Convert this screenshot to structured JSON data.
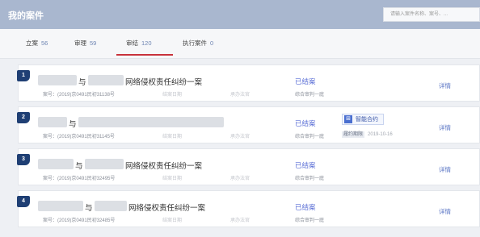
{
  "header": {
    "title": "我的案件",
    "search_placeholder": "请输入案件名称、案号、..."
  },
  "tabs": [
    {
      "label": "立案",
      "count": "56"
    },
    {
      "label": "审理",
      "count": "59"
    },
    {
      "label": "审结",
      "count": "120"
    },
    {
      "label": "执行案件",
      "count": "0"
    }
  ],
  "active_tab": "审结",
  "cases": [
    {
      "number": "1",
      "joiner": "与",
      "title_suffix": "网络侵权责任纠纷一案",
      "case_no": "案号：(2019)京0491民初31138号",
      "filing_date": "结案日期",
      "judge": "承办法官",
      "status": "已结案",
      "court": "综合审判一庭",
      "details": "详情"
    },
    {
      "number": "2",
      "joiner": "与",
      "title_suffix": "",
      "case_no": "案号：(2019)京0491民初31145号",
      "filing_date": "结案日期",
      "judge": "承办法官",
      "status": "已结案",
      "court": "综合审判一庭",
      "smart_contract": "智能合约",
      "archive_label": "履约期限",
      "archive_date": "2019-10-16",
      "details": "详情"
    },
    {
      "number": "3",
      "joiner": "与",
      "title_suffix": "网络侵权责任纠纷一案",
      "case_no": "案号：(2019)京0491民初32495号",
      "filing_date": "结案日期",
      "judge": "承办法官",
      "status": "已结案",
      "court": "综合审判一庭",
      "details": "详情"
    },
    {
      "number": "4",
      "joiner": "与",
      "title_suffix": "网络侵权责任纠纷一案",
      "case_no": "案号：(2019)京0491民初32485号",
      "filing_date": "结案日期",
      "judge": "承办法官",
      "status": "已结案",
      "court": "综合审判一庭",
      "details": "详情"
    }
  ]
}
